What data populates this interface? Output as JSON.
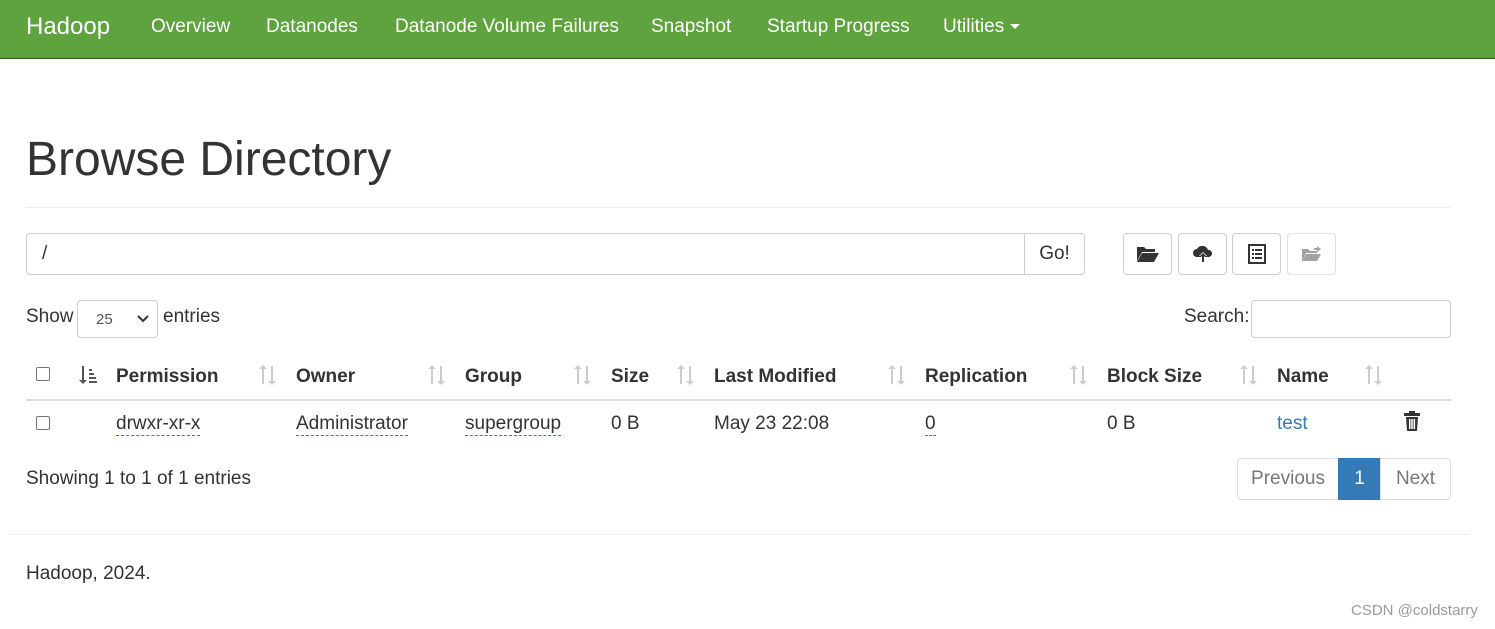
{
  "navbar": {
    "brand": "Hadoop",
    "items": [
      {
        "label": "Overview"
      },
      {
        "label": "Datanodes"
      },
      {
        "label": "Datanode Volume Failures"
      },
      {
        "label": "Snapshot"
      },
      {
        "label": "Startup Progress"
      },
      {
        "label": "Utilities"
      }
    ],
    "color": "#5fa33e"
  },
  "page": {
    "title": "Browse Directory"
  },
  "path_bar": {
    "value": "/",
    "go_label": "Go!",
    "tools": [
      "create-directory-icon",
      "upload-icon",
      "cut-paste-icon",
      "move-icon"
    ]
  },
  "table_controls": {
    "show_label": "Show",
    "length_value": "25",
    "entries_label": "entries",
    "search_label": "Search:",
    "search_value": ""
  },
  "table": {
    "columns": [
      "Permission",
      "Owner",
      "Group",
      "Size",
      "Last Modified",
      "Replication",
      "Block Size",
      "Name"
    ],
    "rows": [
      {
        "permission": "drwxr-xr-x",
        "owner": "Administrator",
        "group": "supergroup",
        "size": "0 B",
        "last_modified": "May 23 22:08",
        "replication": "0",
        "block_size": "0 B",
        "name": "test"
      }
    ]
  },
  "footer_info": {
    "info": "Showing 1 to 1 of 1 entries",
    "previous": "Previous",
    "current_page": "1",
    "next": "Next",
    "accent": "#337ab7"
  },
  "footer": {
    "text": "Hadoop, 2024.",
    "watermark": "CSDN @coldstarry"
  }
}
